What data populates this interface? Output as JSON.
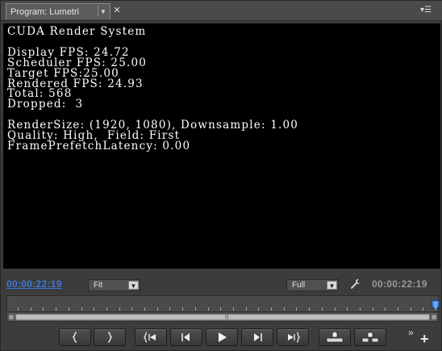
{
  "panel": {
    "tab_label": "Program: Lumetri"
  },
  "overlay": {
    "lines": [
      "CUDA Render System",
      "",
      "Display FPS: 24.72",
      "Scheduler FPS: 25.00",
      "Target FPS:25.00",
      "Rendered FPS: 24.93",
      "Total: 568",
      "Dropped:  3",
      "",
      "RenderSize: (1920, 1080), Downsample: 1.00",
      "Quality: High,  Field: First",
      "FramePrefetchLatency: 0.00"
    ]
  },
  "controls": {
    "current_timecode": "00:00:22:19",
    "zoom_value": "Fit",
    "resolution_value": "Full",
    "duration_timecode": "00:00:22:19"
  },
  "timeline": {
    "playhead_fraction": 1.0
  },
  "transport": {
    "buttons": [
      "mark-in",
      "mark-out",
      "go-to-in",
      "step-back",
      "play",
      "step-forward",
      "go-to-out",
      "lift",
      "extract"
    ]
  },
  "colors": {
    "timecode_active": "#3c78dc",
    "overlay_text": "#ffffff",
    "viewer_bg": "#000000"
  }
}
